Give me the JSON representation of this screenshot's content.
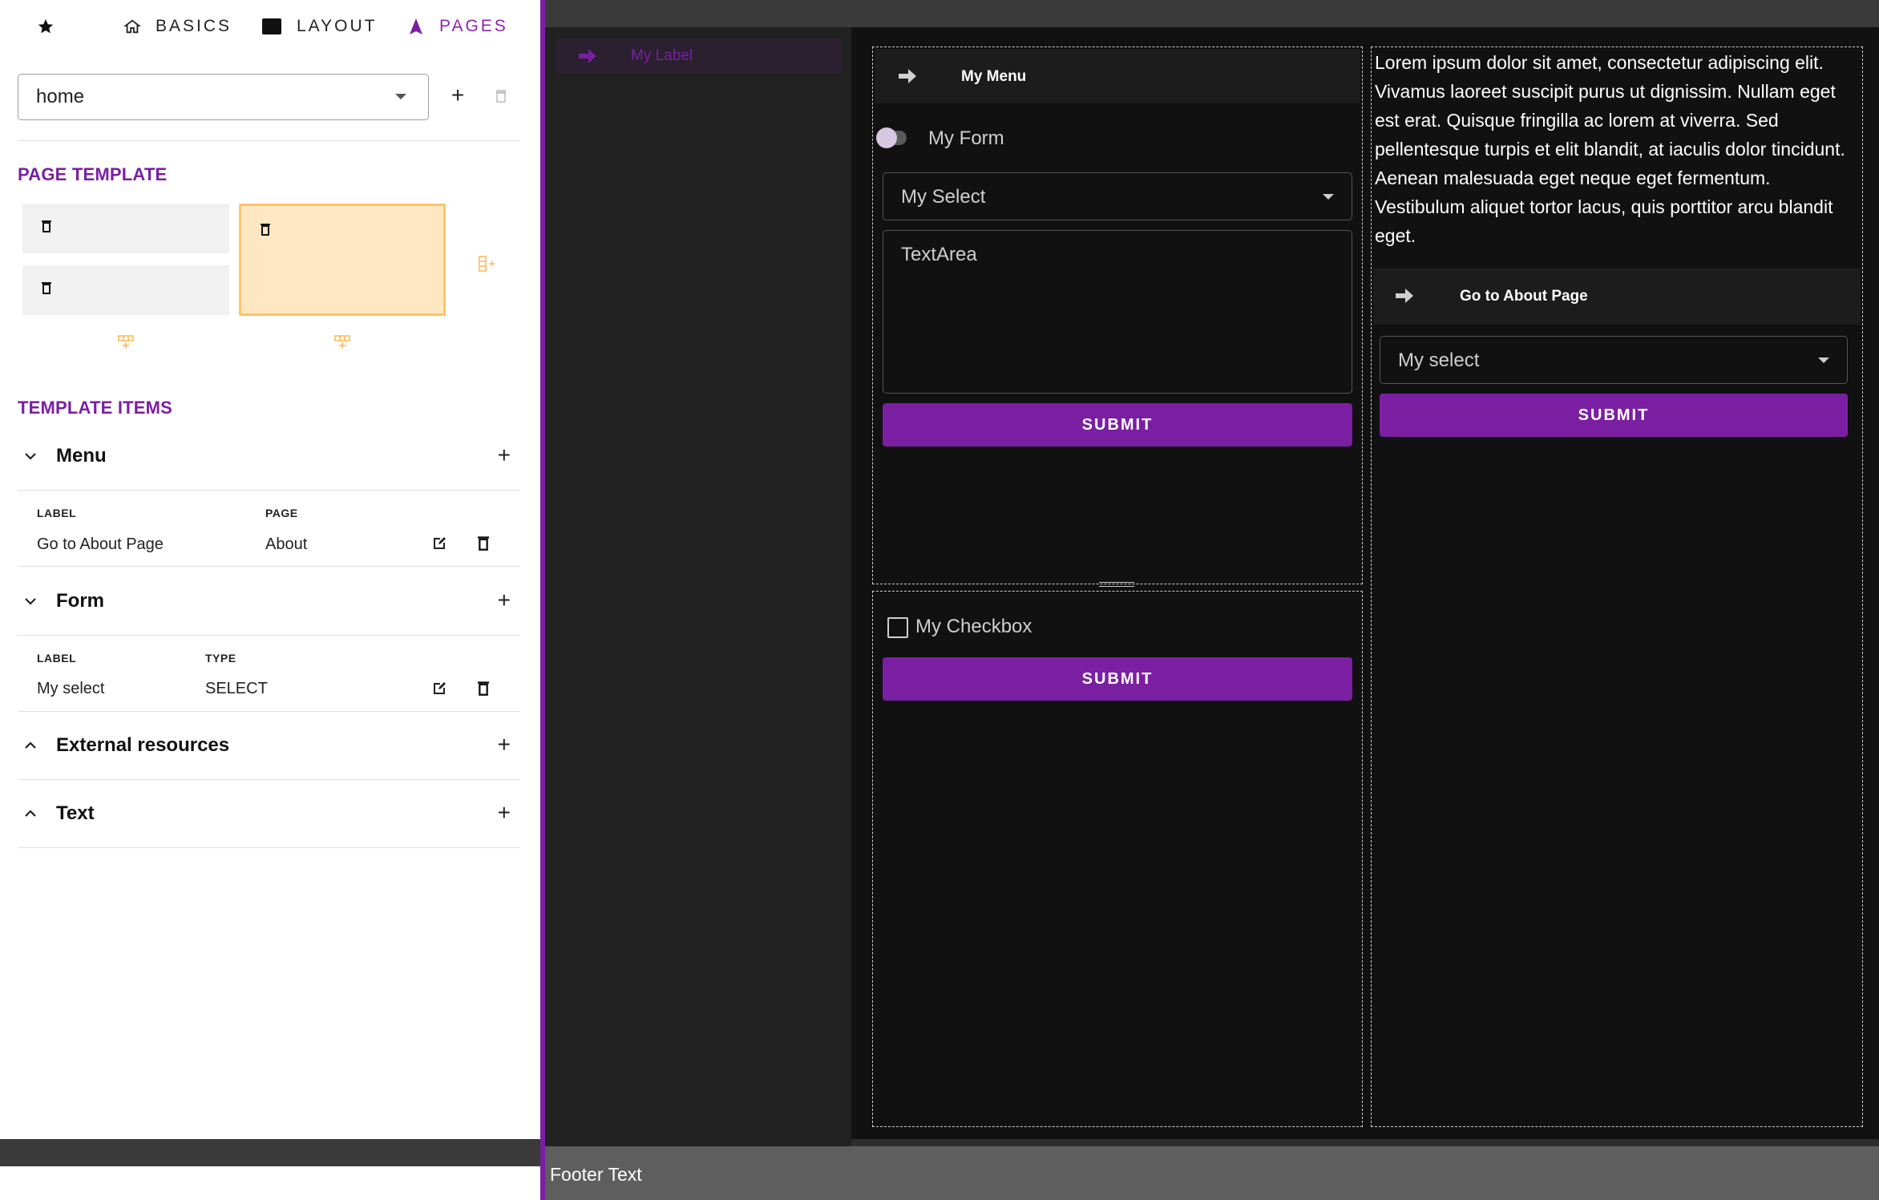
{
  "nav": {
    "favorites_icon": "star-icon",
    "items": [
      {
        "label": "BASICS",
        "icon": "home-icon"
      },
      {
        "label": "LAYOUT",
        "icon": "window-icon"
      },
      {
        "label": "PAGES",
        "icon": "navigation-icon",
        "active": true
      }
    ]
  },
  "page_selector": {
    "value": "home"
  },
  "page_template": {
    "title": "PAGE TEMPLATE"
  },
  "template_items": {
    "title": "TEMPLATE ITEMS",
    "groups": [
      {
        "name": "Menu",
        "expanded": true,
        "columns": [
          "LABEL",
          "PAGE"
        ],
        "rows": [
          [
            "Go to About Page",
            "About"
          ]
        ]
      },
      {
        "name": "Form",
        "expanded": true,
        "columns": [
          "LABEL",
          "TYPE"
        ],
        "rows": [
          [
            "My select",
            "SELECT"
          ]
        ]
      },
      {
        "name": "External resources",
        "expanded": false
      },
      {
        "name": "Text",
        "expanded": false
      }
    ]
  },
  "preview": {
    "sidenav_label": "My Label",
    "menu_title": "My Menu",
    "form_label": "My Form",
    "select_placeholder": "My Select",
    "textarea_placeholder": "TextArea",
    "submit_label": "SUBMIT",
    "checkbox_label": "My Checkbox",
    "lorem": "Lorem ipsum dolor sit amet, consectetur adipiscing elit. Vivamus laoreet suscipit purus ut dignissim. Nullam eget est erat. Quisque fringilla ac lorem at viverra. Sed pellentesque turpis et elit blandit, at iaculis dolor tincidunt. Aenean malesuada eget neque eget fermentum. Vestibulum aliquet tortor lacus, quis porttitor arcu blandit eget.",
    "about_menu_item": "Go to About Page",
    "right_select": "My select",
    "footer": "Footer Text"
  },
  "colors": {
    "accent": "#7b1fa2",
    "highlight": "#ffb74d",
    "dark_bg": "#111111"
  }
}
